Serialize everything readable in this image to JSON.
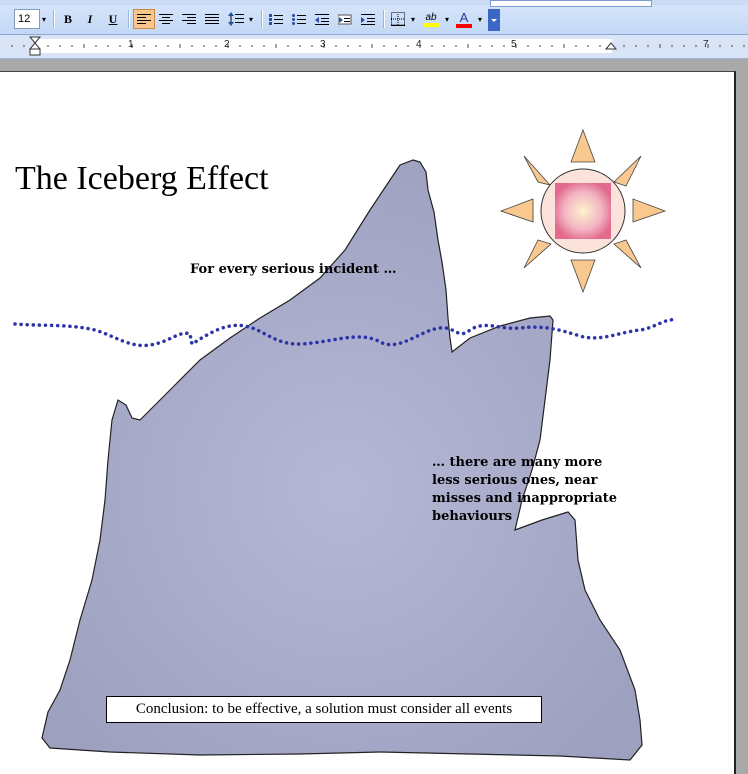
{
  "toolbar": {
    "font_size": "12",
    "bold_label": "B",
    "italic_label": "I",
    "underline_label": "U",
    "highlight_label": "ab",
    "font_color_label": "A",
    "highlight_color": "#ffff00",
    "font_color": "#ff0000"
  },
  "ruler": {
    "numbers": [
      "1",
      "2",
      "3",
      "4",
      "5",
      "7"
    ]
  },
  "document": {
    "title": "The Iceberg Effect",
    "caption_top": "For every serious incident …",
    "caption_bottom_lines": [
      "… there are many more",
      "less serious ones, near",
      "misses and inappropriate",
      "behaviours"
    ],
    "conclusion": "Conclusion: to be effective, a solution must consider all events"
  },
  "colors": {
    "iceberg": "#a8aac8",
    "water_line": "#2a34a8",
    "sun_ray": "#f7b86a",
    "sun_core": "#fbe3df",
    "sun_square": "#e8799a"
  }
}
